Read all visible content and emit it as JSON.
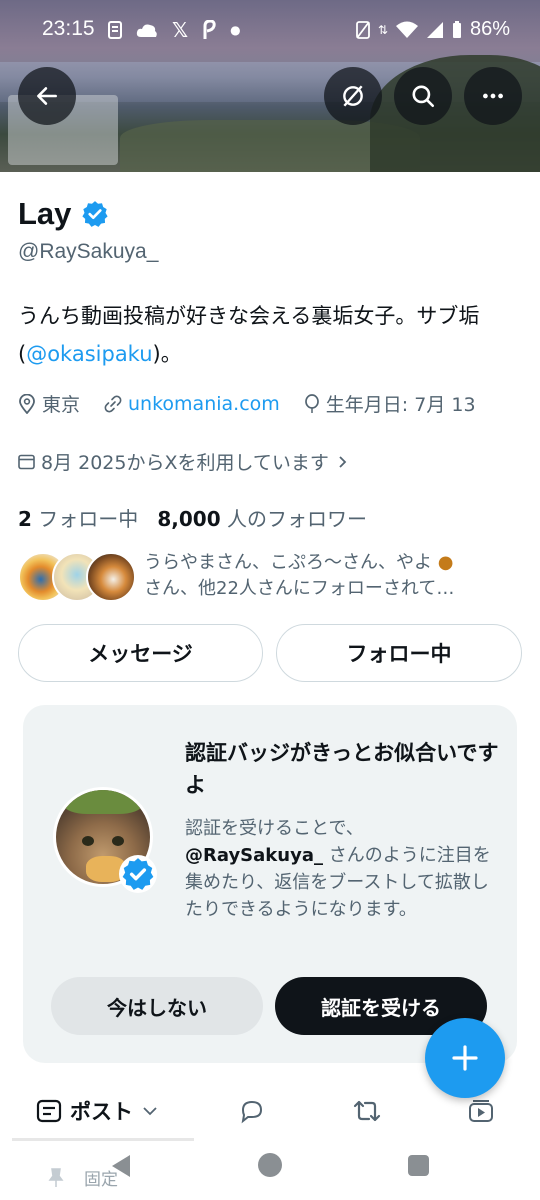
{
  "status_bar": {
    "time": "23:15",
    "battery": "86%",
    "left_icons": [
      "notification-icon",
      "cloud-icon",
      "x-icon",
      "feather-icon",
      "dot-icon"
    ],
    "right_icons": [
      "no-sim-icon",
      "data-arrows-icon",
      "wifi-icon",
      "signal-icon",
      "battery-icon"
    ]
  },
  "header_buttons": [
    "back-arrow-icon",
    "grok-icon",
    "search-icon",
    "more-icon"
  ],
  "profile": {
    "name": "Lay",
    "handle": "@RaySakuya_",
    "bio_before": "うんち動画投稿が好きな会える裏垢女子。サブ垢(",
    "bio_link": "@okasipaku",
    "bio_after": ")。",
    "location": "東京",
    "website": "unkomania.com",
    "birthday": "生年月日: 7月 13",
    "joined": "8月 2025からXを利用しています",
    "following_count": "2",
    "following_label": "フォロー中",
    "followers_count": "8,000",
    "followers_label": "人のフォロワー",
    "followed_by_line1": "うらやまさん、こぷろ〜さん、やよ",
    "followed_by_line2": "さん、他22人さんにフォローされて…"
  },
  "actions": {
    "message": "メッセージ",
    "following": "フォロー中"
  },
  "verify_card": {
    "title": "認証バッジがきっとお似合いですよ",
    "desc_before": "認証を受けることで、",
    "desc_handle": "@RaySakuya_",
    "desc_after": " さんのように注目を集めたり、返信をブーストして拡散したりできるようになります。",
    "not_now": "今はしない",
    "get_verified": "認証を受ける"
  },
  "tabs": {
    "posts": "ポスト",
    "pinned": "固定"
  },
  "colors": {
    "accent": "#1d9bf0",
    "text": "#0f1419",
    "secondary": "#536471"
  }
}
